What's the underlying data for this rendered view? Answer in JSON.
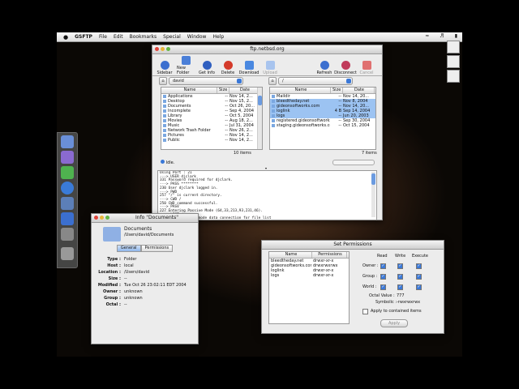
{
  "menubar": {
    "app": "GSFTP",
    "items": [
      "File",
      "Edit",
      "Bookmarks",
      "Special",
      "Window",
      "Help"
    ]
  },
  "ftp_window": {
    "title": "ftp.netbsd.org",
    "toolbar": {
      "sidebar": "Sidebar",
      "new_folder": "New Folder",
      "get_info": "Get Info",
      "delete": "Delete",
      "download": "Download",
      "upload": "Upload",
      "refresh": "Refresh",
      "disconnect": "Disconnect",
      "cancel": "Cancel"
    },
    "left_path": "david",
    "right_path": "/",
    "columns": {
      "name": "Name",
      "size": "Size",
      "date": "Date"
    },
    "local_files": [
      {
        "name": "Applications",
        "size": "--",
        "date": "Nov 14, 2..."
      },
      {
        "name": "Desktop",
        "size": "--",
        "date": "Nov 15, 2..."
      },
      {
        "name": "Documents",
        "size": "--",
        "date": "Oct 26, 20..."
      },
      {
        "name": "Incomplete",
        "size": "--",
        "date": "Sep 4, 2004"
      },
      {
        "name": "Library",
        "size": "--",
        "date": "Oct 5, 2004"
      },
      {
        "name": "Movies",
        "size": "--",
        "date": "Aug 18, 2..."
      },
      {
        "name": "Music",
        "size": "--",
        "date": "Jul 31, 2004"
      },
      {
        "name": "Network Trash Folder",
        "size": "--",
        "date": "Nov 26, 2..."
      },
      {
        "name": "Pictures",
        "size": "--",
        "date": "Nov 14, 2..."
      },
      {
        "name": "Public",
        "size": "--",
        "date": "Nov 14, 2..."
      }
    ],
    "remote_files": [
      {
        "name": "Maildir",
        "size": "--",
        "date": "Nov 14, 20...",
        "sel": false
      },
      {
        "name": "bleedtheday.net",
        "size": "--",
        "date": "Nov 8, 2004",
        "sel": true
      },
      {
        "name": "gideonsoftworks.com",
        "size": "--",
        "date": "Nov 14, 20...",
        "sel": true
      },
      {
        "name": "loglink",
        "size": "4 B",
        "date": "Sep 14, 2004",
        "sel": true
      },
      {
        "name": "logs",
        "size": "--",
        "date": "Jun 20, 2003",
        "sel": true
      },
      {
        "name": "registered.gideonsoftworks...",
        "size": "--",
        "date": "Sep 30, 2004",
        "sel": false
      },
      {
        "name": "staging.gideonsoftworks.com",
        "size": "--",
        "date": "Oct 15, 2004",
        "sel": false
      }
    ],
    "local_count": "10 items",
    "remote_count": "7 items",
    "status": "Idle.",
    "log": "Using Port : 21\n---> USER djclark\n331 Password required for djclark.\n---> PASS ********\n230 User djclark logged in.\n---> PWD\n257 \"/\" is current directory.\n---> CWD /\n250 CWD command successful.\n---> PASV\n227 Entering Passive Mode (64,33,213,93,231,46).\n---> LIST /\n150 Opening ASCII mode data connection for file list"
  },
  "info_window": {
    "title": "Info \"Documents\"",
    "name": "Documents",
    "path": "/Users/david/Documents",
    "tabs": [
      "General",
      "Permissions"
    ],
    "fields": [
      {
        "k": "Type :",
        "v": "Folder"
      },
      {
        "k": "Host :",
        "v": "local"
      },
      {
        "k": "Location :",
        "v": "/Users/david"
      },
      {
        "k": "Size :",
        "v": "--"
      },
      {
        "k": "Modified :",
        "v": "Tue Oct 26 23:02:11 EDT 2004"
      },
      {
        "k": "Owner :",
        "v": "unknown"
      },
      {
        "k": "Group :",
        "v": "unknown"
      },
      {
        "k": "Octal :",
        "v": "--"
      }
    ]
  },
  "perm_window": {
    "title": "Set Permissions",
    "columns": {
      "name": "Name",
      "permissions": "Permissions"
    },
    "rows": [
      {
        "name": "bleedtheday.net",
        "perm": "drwxr-xr-x"
      },
      {
        "name": "gideonsoftworks.com",
        "perm": "drwxrwxrwx"
      },
      {
        "name": "loglink",
        "perm": "drwxr-xr-x"
      },
      {
        "name": "logs",
        "perm": "drwxr-xr-x"
      }
    ],
    "heads": {
      "read": "Read",
      "write": "Write",
      "execute": "Execute"
    },
    "who": [
      "Owner :",
      "Group :",
      "World :"
    ],
    "octal_label": "Octal Value :",
    "octal": "777",
    "symbolic_label": "Symbolic :",
    "symbolic": "-rwxrwxrwx",
    "apply_label": "Apply to contained items",
    "apply_button": "Apply"
  }
}
